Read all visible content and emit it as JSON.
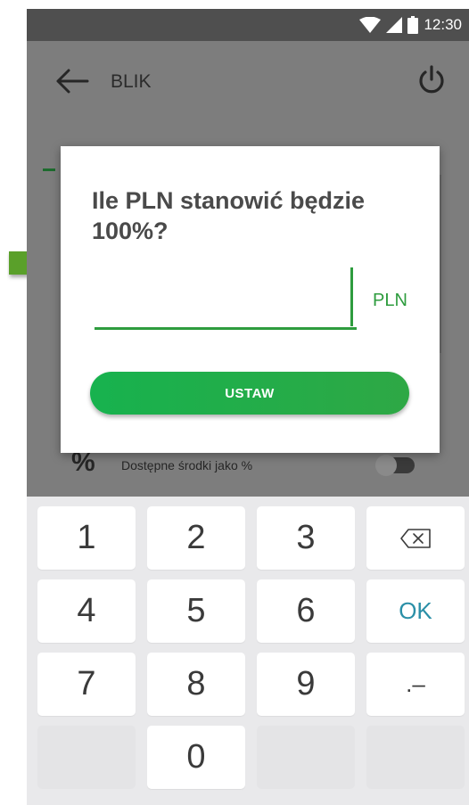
{
  "status_bar": {
    "time": "12:30",
    "icons": [
      "wifi-icon",
      "signal-icon",
      "battery-icon"
    ]
  },
  "toolbar": {
    "title": "BLIK"
  },
  "background_row": {
    "symbol": "%",
    "label": "Dostępne środki jako %",
    "toggle_on": false
  },
  "dialog": {
    "title": "Ile PLN stanowić będzie 100%?",
    "input_value": "",
    "currency": "PLN",
    "button_label": "USTAW"
  },
  "keypad": {
    "k1": "1",
    "k2": "2",
    "k3": "3",
    "k4": "4",
    "k5": "5",
    "k6": "6",
    "k7": "7",
    "k8": "8",
    "k9": "9",
    "k0": "0",
    "ok": "OK",
    "separator": ".–"
  },
  "colors": {
    "accent_green": "#2e9c3e",
    "ok_blue": "#2a8fa7",
    "overlay_gray": "#7d7d7d",
    "arrow_green": "#5aa02c"
  }
}
